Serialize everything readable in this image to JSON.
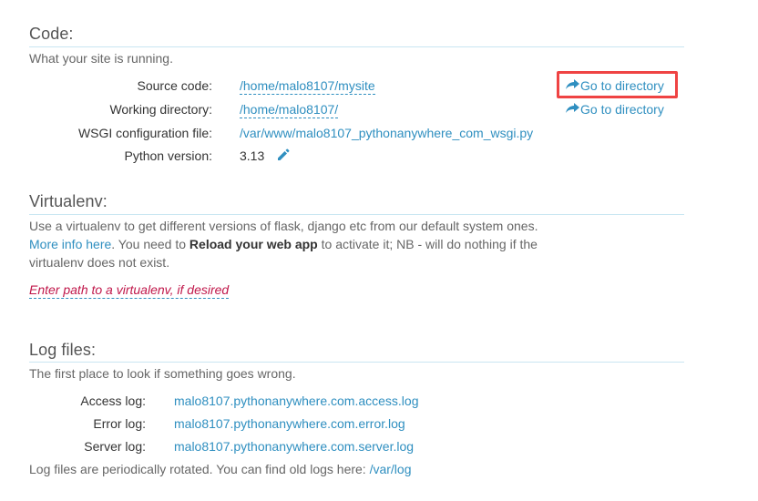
{
  "code": {
    "title": "Code:",
    "description": "What your site is running.",
    "rows": [
      {
        "label": "Source code:",
        "value": "/home/malo8107/mysite"
      },
      {
        "label": "Working directory:",
        "value": "/home/malo8107/"
      },
      {
        "label": "WSGI configuration file:",
        "value": "/var/www/malo8107_pythonanywhere_com_wsgi.py"
      },
      {
        "label": "Python version:",
        "value": "3.13"
      }
    ],
    "goto_labels": [
      "Go to directory",
      "Go to directory"
    ]
  },
  "virtualenv": {
    "title": "Virtualenv:",
    "text_part1": "Use a virtualenv to get different versions of flask, django etc from our default system ones. ",
    "more_info_link": "More info here",
    "text_part2": ". You need to ",
    "reload_bold": "Reload your web app",
    "text_part3": " to activate it; NB - will do nothing if the virtualenv does not exist.",
    "input_placeholder": "Enter path to a virtualenv, if desired"
  },
  "logs": {
    "title": "Log files:",
    "description": "The first place to look if something goes wrong.",
    "rows": [
      {
        "label": "Access log:",
        "value": "malo8107.pythonanywhere.com.access.log"
      },
      {
        "label": "Error log:",
        "value": "malo8107.pythonanywhere.com.error.log"
      },
      {
        "label": "Server log:",
        "value": "malo8107.pythonanywhere.com.server.log"
      }
    ],
    "rotation_text": "Log files are periodically rotated. You can find old logs here: ",
    "old_logs_link": "/var/log"
  },
  "colors": {
    "link": "#2f8fc0",
    "highlight": "#ef4343",
    "placeholder": "#c0174a"
  },
  "icons": [
    "share-arrow-icon",
    "pencil-icon"
  ]
}
